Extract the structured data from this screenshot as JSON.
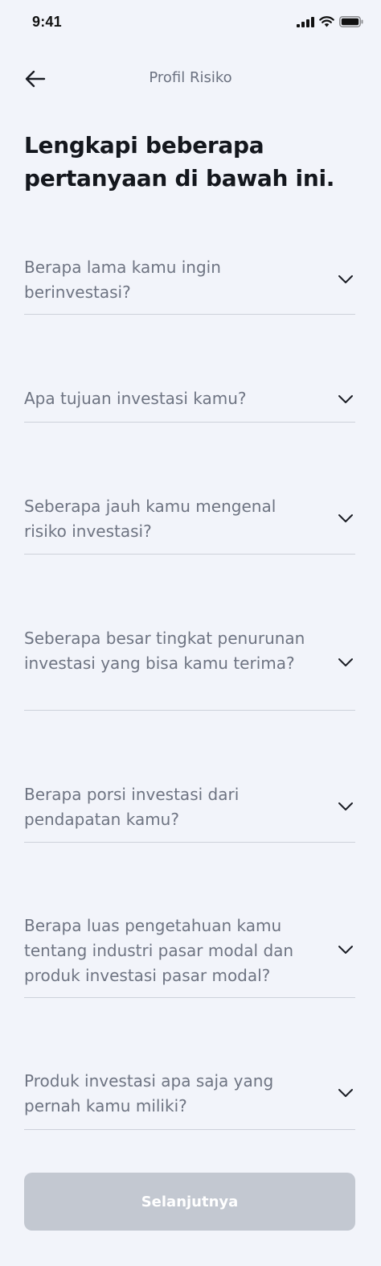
{
  "status_bar": {
    "time": "9:41",
    "icons": [
      "signal-icon",
      "wifi-icon",
      "battery-icon"
    ]
  },
  "header": {
    "back_icon": "arrow-left-icon",
    "title": "Profil Risiko"
  },
  "headline": "Lengkapi beberapa pertanyaan di bawah ini.",
  "questions": [
    {
      "label": "Berapa lama kamu ingin berinvestasi?",
      "icon": "chevron-down-icon"
    },
    {
      "label": "Apa tujuan investasi kamu?",
      "icon": "chevron-down-icon"
    },
    {
      "label": "Seberapa jauh kamu mengenal risiko investasi?",
      "icon": "chevron-down-icon"
    },
    {
      "label": "Seberapa besar tingkat penurunan investasi yang bisa kamu terima?",
      "icon": "chevron-down-icon"
    },
    {
      "label": "Berapa porsi investasi dari pendapatan kamu?",
      "icon": "chevron-down-icon"
    },
    {
      "label": "Berapa luas pengetahuan kamu tentang industri pasar modal dan produk investasi pasar modal?",
      "icon": "chevron-down-icon"
    },
    {
      "label": "Produk investasi apa saja yang pernah kamu miliki?",
      "icon": "chevron-down-icon"
    }
  ],
  "next_button": {
    "label": "Selanjutnya",
    "enabled": false
  },
  "colors": {
    "background": "#f2f4fa",
    "question_text": "#6e7482",
    "divider": "#cdd1da",
    "button_disabled": "#c3c8d1"
  }
}
